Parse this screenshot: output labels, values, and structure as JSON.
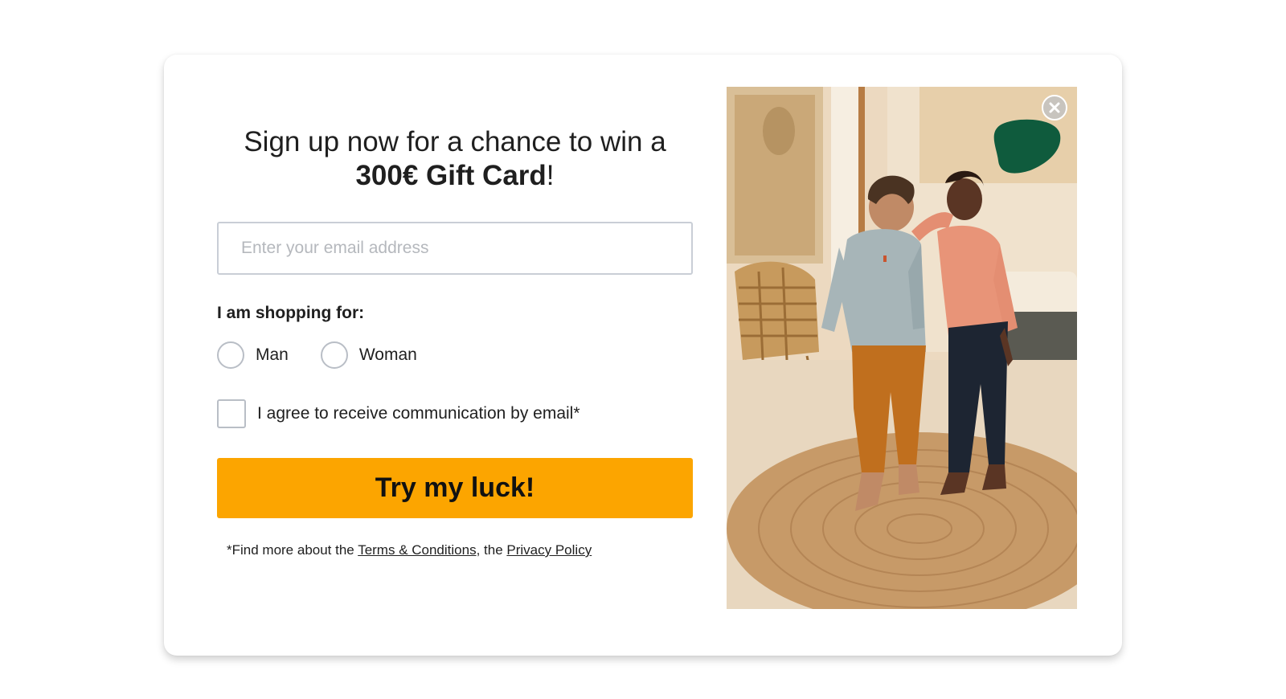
{
  "popup": {
    "headline_line1": "Sign up now for a chance to win a",
    "headline_prize": "300€ Gift Card",
    "headline_suffix": "!",
    "email": {
      "placeholder": "Enter your email address",
      "value": ""
    },
    "shopping_label": "I am shopping for:",
    "shopping_options": [
      {
        "label": "Man",
        "selected": false
      },
      {
        "label": "Woman",
        "selected": false
      }
    ],
    "consent": {
      "label": "I agree to receive communication by email*",
      "checked": false
    },
    "cta_label": "Try my luck!",
    "legal": {
      "prefix": "*Find more about the ",
      "terms_link": "Terms & Conditions",
      "middle": ", the ",
      "privacy_link": "Privacy Policy"
    },
    "close_icon": "close-icon",
    "image": {
      "subject": "couple-photo"
    }
  },
  "colors": {
    "cta_background": "#fca500",
    "brand_blob": "#0f5b3d",
    "input_border": "#c9ced6",
    "text": "#1f1f1f"
  }
}
